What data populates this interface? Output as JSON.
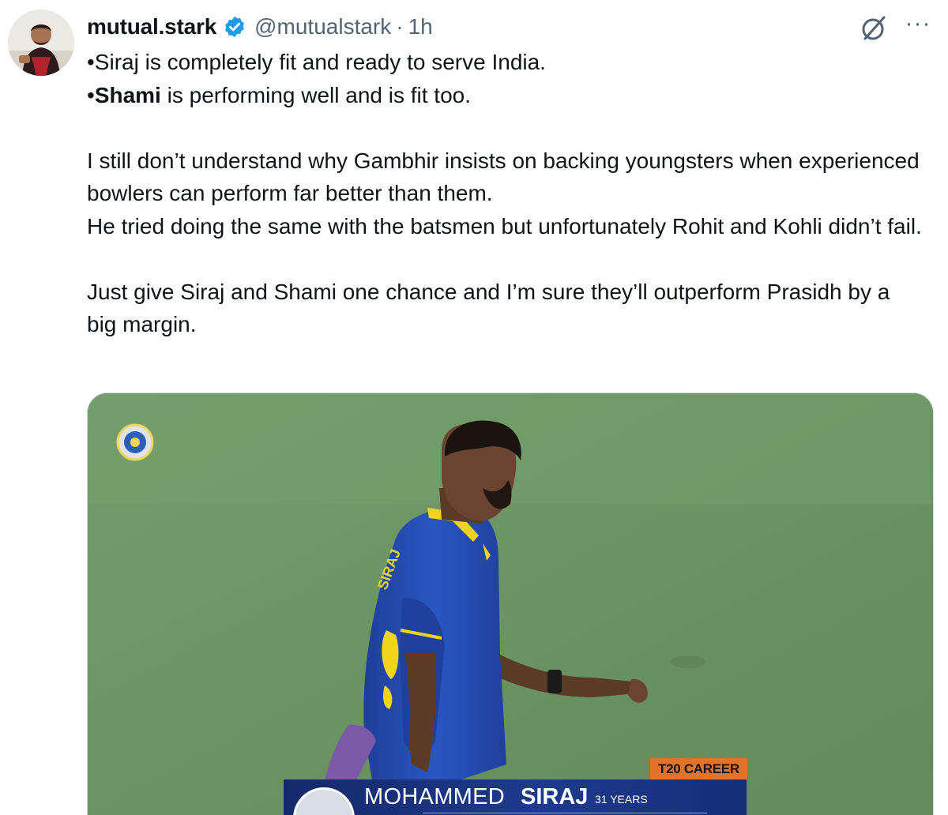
{
  "tweet": {
    "author": {
      "display_name": "mutual.stark",
      "handle": "@mutualstark",
      "separator": "·",
      "time": "1h",
      "verified": true,
      "avatar_icon": "avatar-photo"
    },
    "actions": {
      "grok_icon": "grok-icon",
      "more_icon": "more-icon",
      "more_label": "···"
    },
    "text": {
      "line1": "•Siraj is completely fit and ready to serve India.",
      "line2_bullet": "•",
      "line2_bold": "Shami",
      "line2_rest": " is performing well and is fit too.",
      "para2": "I still don’t understand why Gambhir insists on backing youngsters when experienced bowlers can perform far better than them.",
      "para3": "He tried doing the same with the batsmen but unfortunately Rohit and Kohli didn’t fail.",
      "para4": "Just give Siraj and Shami one chance and I’m sure they’ll outperform Prasidh by a big margin."
    },
    "media": {
      "career_badge": "T20 CAREER",
      "player_first": "MOHAMMED",
      "player_last": "SIRAJ",
      "player_age": "31 YEARS",
      "colors": {
        "pitch_green": "#6e9766",
        "jersey_blue": "#2a4fb5",
        "badge_orange": "#e2732a",
        "strip_navy": "#15296a"
      }
    }
  },
  "colors": {
    "verified_blue": "#1d9bf0",
    "secondary_text": "#536471",
    "primary_text": "#0f1419"
  }
}
